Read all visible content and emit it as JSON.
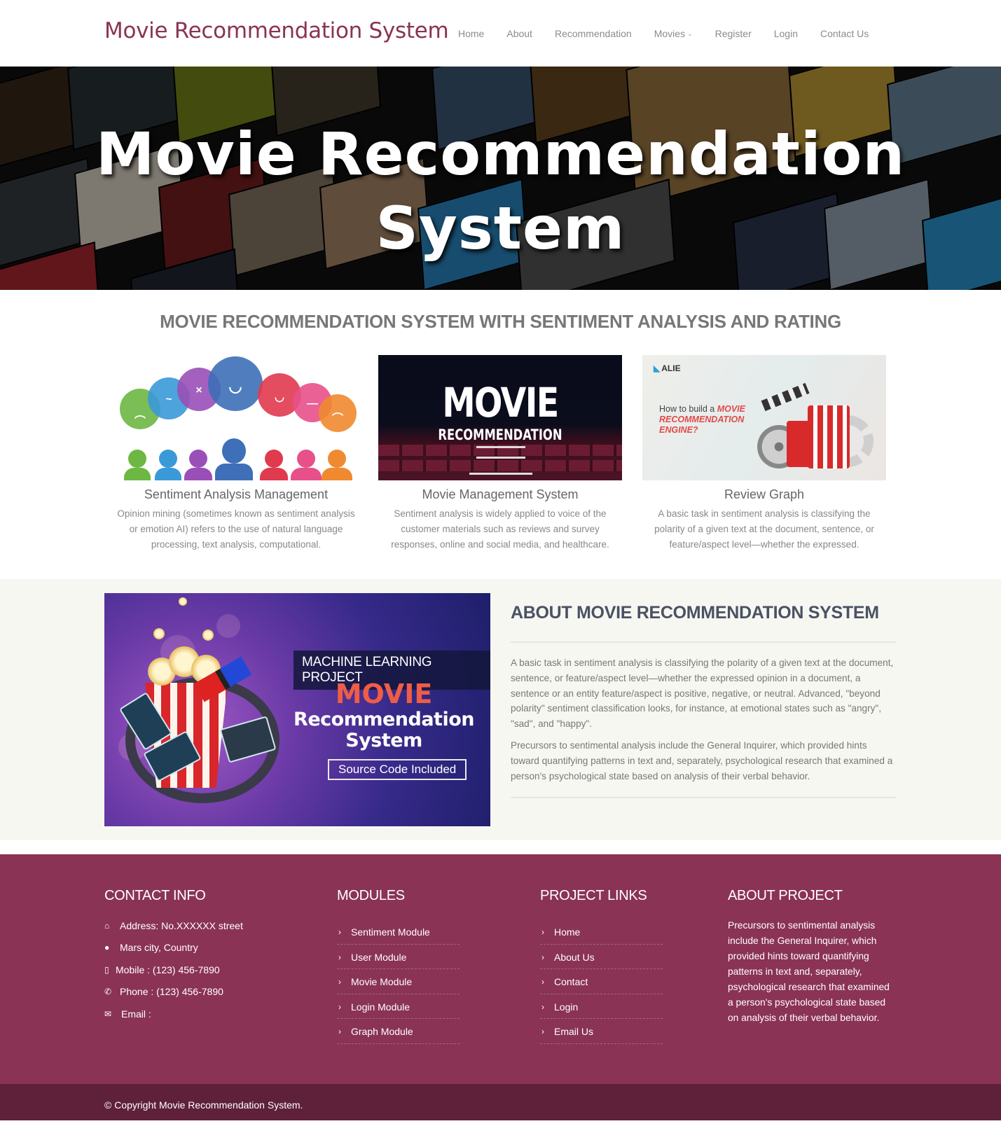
{
  "navbar": {
    "brand": "Movie Recommendation System",
    "items": [
      {
        "label": "Home"
      },
      {
        "label": "About"
      },
      {
        "label": "Recommendation"
      },
      {
        "label": "Movies",
        "has_dropdown": true
      },
      {
        "label": "Register"
      },
      {
        "label": "Login"
      },
      {
        "label": "Contact Us"
      }
    ],
    "dropdown_icon": "chevron-down-icon"
  },
  "hero": {
    "title_line1": "Movie Recommendation",
    "title_line2": "System"
  },
  "features": {
    "heading": "MOVIE RECOMMENDATION SYSTEM WITH SENTIMENT ANALYSIS AND RATING",
    "cards": [
      {
        "title": "Sentiment Analysis Management",
        "text": "Opinion mining (sometimes known as sentiment analysis or emotion AI) refers to the use of natural language processing, text analysis, computational."
      },
      {
        "title": "Movie Management System",
        "text": "Sentiment analysis is widely applied to voice of the customer materials such as reviews and survey responses, online and social media, and healthcare.",
        "image_text": {
          "line1": "MOVIE",
          "line2": "RECOMMENDATION"
        }
      },
      {
        "title": "Review Graph",
        "text": "A basic task in sentiment analysis is classifying the polarity of a given text at the document, sentence, or feature/aspect level—whether the expressed.",
        "image_text": {
          "logo": "ALIE",
          "q_plain": "How to build a ",
          "q_emph1": "MOVIE",
          "q_emph2": "RECOMMENDATION",
          "q_emph3": "ENGINE?"
        }
      }
    ]
  },
  "about": {
    "image_text": {
      "banner": "MACHINE LEARNING PROJECT",
      "movie": "MOVIE",
      "line1": "Recommendation",
      "line2": "System",
      "badge": "Source Code Included"
    },
    "title": "ABOUT MOVIE RECOMMENDATION SYSTEM",
    "paragraphs": [
      "A basic task in sentiment analysis is classifying the polarity of a given text at the document, sentence, or feature/aspect level—whether the expressed opinion in a document, a sentence or an entity feature/aspect is positive, negative, or neutral. Advanced, \"beyond polarity\" sentiment classification looks, for instance, at emotional states such as \"angry\", \"sad\", and \"happy\".",
      "Precursors to sentimental analysis include the General Inquirer, which provided hints toward quantifying patterns in text and, separately, psychological research that examined a person's psychological state based on analysis of their verbal behavior."
    ]
  },
  "footer": {
    "contact": {
      "title": "CONTACT INFO",
      "items": [
        {
          "icon": "home-icon",
          "glyph": "⌂",
          "text": "Address: No.XXXXXX street"
        },
        {
          "icon": "globe-icon",
          "glyph": "●",
          "text": "Mars city, Country"
        },
        {
          "icon": "mobile-icon",
          "glyph": "▯",
          "text": "Mobile : (123) 456-7890"
        },
        {
          "icon": "phone-icon",
          "glyph": "✆",
          "text": "Phone : (123) 456-7890"
        },
        {
          "icon": "envelope-icon",
          "glyph": "✉",
          "text": "Email :"
        }
      ]
    },
    "modules": {
      "title": "MODULES",
      "items": [
        "Sentiment Module",
        "User Module",
        "Movie Module",
        "Login Module",
        "Graph Module"
      ]
    },
    "project_links": {
      "title": "PROJECT LINKS",
      "items": [
        "Home",
        "About Us",
        "Contact",
        "Login",
        "Email Us"
      ]
    },
    "about_project": {
      "title": "ABOUT PROJECT",
      "text": "Precursors to sentimental analysis include the General Inquirer, which provided hints toward quantifying patterns in text and, separately, psychological research that examined a person's psychological state based on analysis of their verbal behavior."
    },
    "copyright": "© Copyright Movie Recommendation System."
  },
  "colors": {
    "brand": "#8a3355",
    "footer_bg": "#8a3355",
    "copyright_bg": "#5f2139",
    "about_bg": "#f7f7f2"
  }
}
